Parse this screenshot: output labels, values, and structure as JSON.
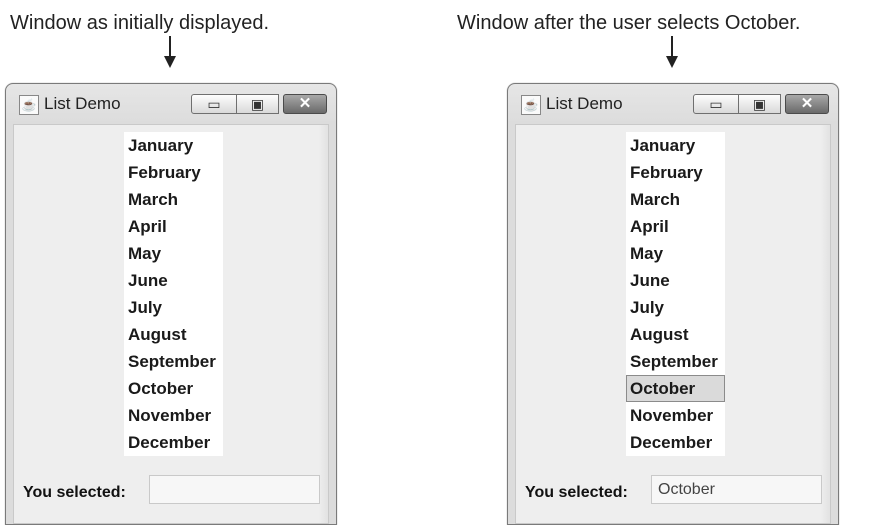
{
  "captions": {
    "left": "Window as initially displayed.",
    "right": "Window after the user selects October."
  },
  "window": {
    "title": "List Demo",
    "icon": "java-cup-icon",
    "controls": [
      "minimize-icon",
      "maximize-icon",
      "close-icon"
    ]
  },
  "months": [
    "January",
    "February",
    "March",
    "April",
    "May",
    "June",
    "July",
    "August",
    "September",
    "October",
    "November",
    "December"
  ],
  "initial": {
    "selected_label": "You selected:",
    "selected_value": ""
  },
  "after": {
    "selected_label": "You selected:",
    "selected_value": "October",
    "selected_index": 9
  }
}
